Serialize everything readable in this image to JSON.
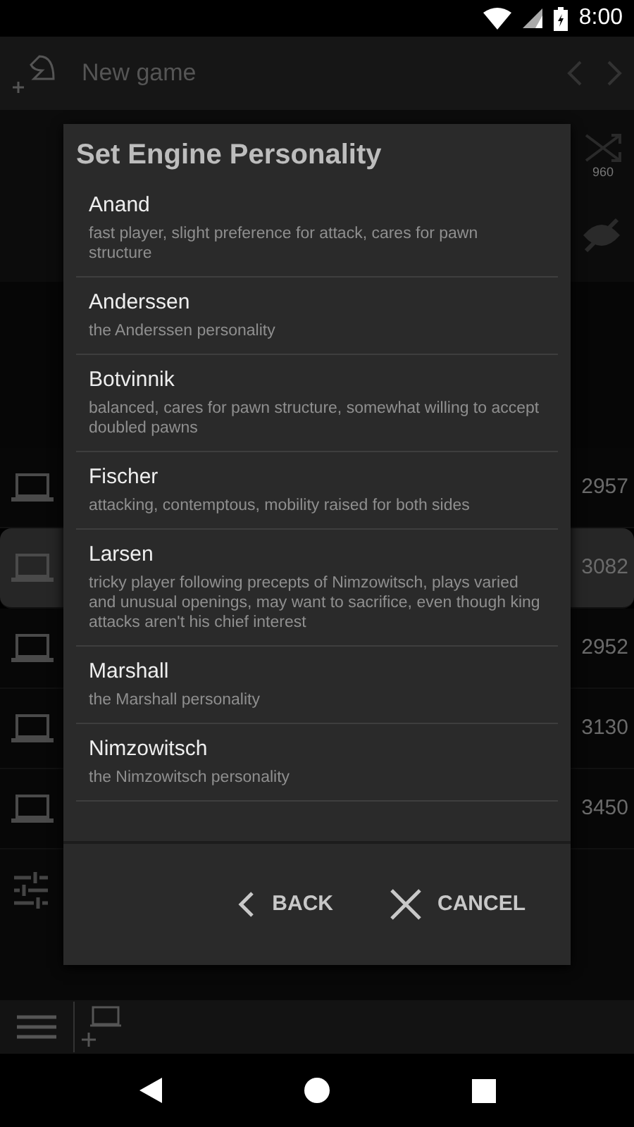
{
  "status_bar": {
    "time": "8:00"
  },
  "toolbar": {
    "title": "New game"
  },
  "side_icons": {
    "variant_label": "960"
  },
  "engines": [
    {
      "rating": "2957",
      "selected": false
    },
    {
      "rating": "3082",
      "selected": true
    },
    {
      "rating": "2952",
      "selected": false
    },
    {
      "rating": "3130",
      "selected": false
    },
    {
      "rating": "3450",
      "selected": false
    }
  ],
  "dialog": {
    "title": "Set Engine Personality",
    "items": [
      {
        "name": "Anand",
        "description": "fast player, slight preference for attack, cares for pawn structure"
      },
      {
        "name": "Anderssen",
        "description": "the Anderssen personality"
      },
      {
        "name": "Botvinnik",
        "description": "balanced, cares for pawn structure, somewhat willing to accept doubled pawns"
      },
      {
        "name": "Fischer",
        "description": "attacking, contemptous, mobility raised for both sides"
      },
      {
        "name": "Larsen",
        "description": "tricky player following precepts of Nimzowitsch, plays varied and unusual openings, may want to sacrifice, even though king attacks aren't his chief interest"
      },
      {
        "name": "Marshall",
        "description": "the Marshall personality"
      },
      {
        "name": "Nimzowitsch",
        "description": "the Nimzowitsch personality"
      }
    ],
    "buttons": [
      {
        "label": "BACK",
        "kind": "back"
      },
      {
        "label": "CANCEL",
        "kind": "cancel"
      }
    ]
  }
}
